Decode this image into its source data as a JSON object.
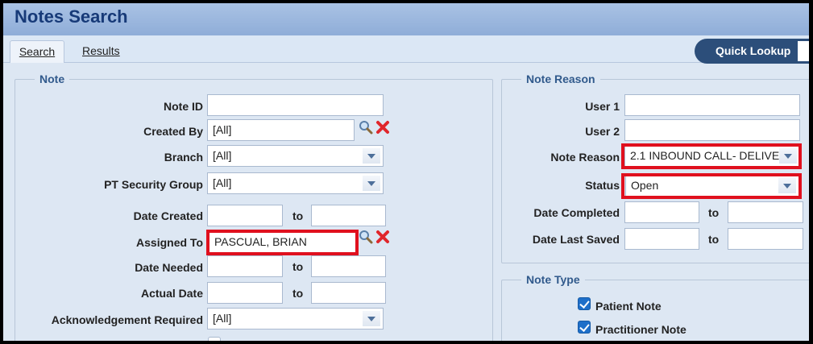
{
  "window": {
    "title": "Notes Search"
  },
  "tabs": [
    {
      "label": "Search",
      "active": true
    },
    {
      "label": "Results",
      "active": false
    }
  ],
  "quick_lookup": {
    "label": "Quick Lookup"
  },
  "note_group": {
    "legend": "Note",
    "note_id": {
      "label": "Note ID",
      "value": ""
    },
    "created_by": {
      "label": "Created By",
      "value": "[All]"
    },
    "branch": {
      "label": "Branch",
      "value": "[All]"
    },
    "pt_security_group": {
      "label": "PT Security Group",
      "value": "[All]"
    },
    "date_created": {
      "label": "Date Created",
      "from": "",
      "to_label": "to",
      "to": ""
    },
    "assigned_to": {
      "label": "Assigned To",
      "value": "PASCUAL, BRIAN"
    },
    "date_needed": {
      "label": "Date Needed",
      "from": "",
      "to_label": "to",
      "to": ""
    },
    "actual_date": {
      "label": "Actual Date",
      "from": "",
      "to_label": "to",
      "to": ""
    },
    "acknowledgement_required": {
      "label": "Acknowledgement Required",
      "value": "[All]"
    }
  },
  "note_reason_group": {
    "legend": "Note Reason",
    "user1": {
      "label": "User 1",
      "value": ""
    },
    "user2": {
      "label": "User 2",
      "value": ""
    },
    "note_reason": {
      "label": "Note Reason",
      "value": "2.1 INBOUND CALL- DELIVE"
    },
    "status": {
      "label": "Status",
      "value": "Open"
    },
    "date_completed": {
      "label": "Date Completed",
      "from": "",
      "to_label": "to",
      "to": ""
    },
    "date_last_saved": {
      "label": "Date Last Saved",
      "from": "",
      "to_label": "to",
      "to": ""
    }
  },
  "note_type_group": {
    "legend": "Note Type",
    "options": [
      {
        "label": "Patient Note",
        "checked": true
      },
      {
        "label": "Practitioner Note",
        "checked": true
      }
    ]
  },
  "colors": {
    "highlight": "#e0101e",
    "title": "#173a78",
    "accent": "#2c4e7a",
    "checkbox": "#1e6fc9"
  }
}
